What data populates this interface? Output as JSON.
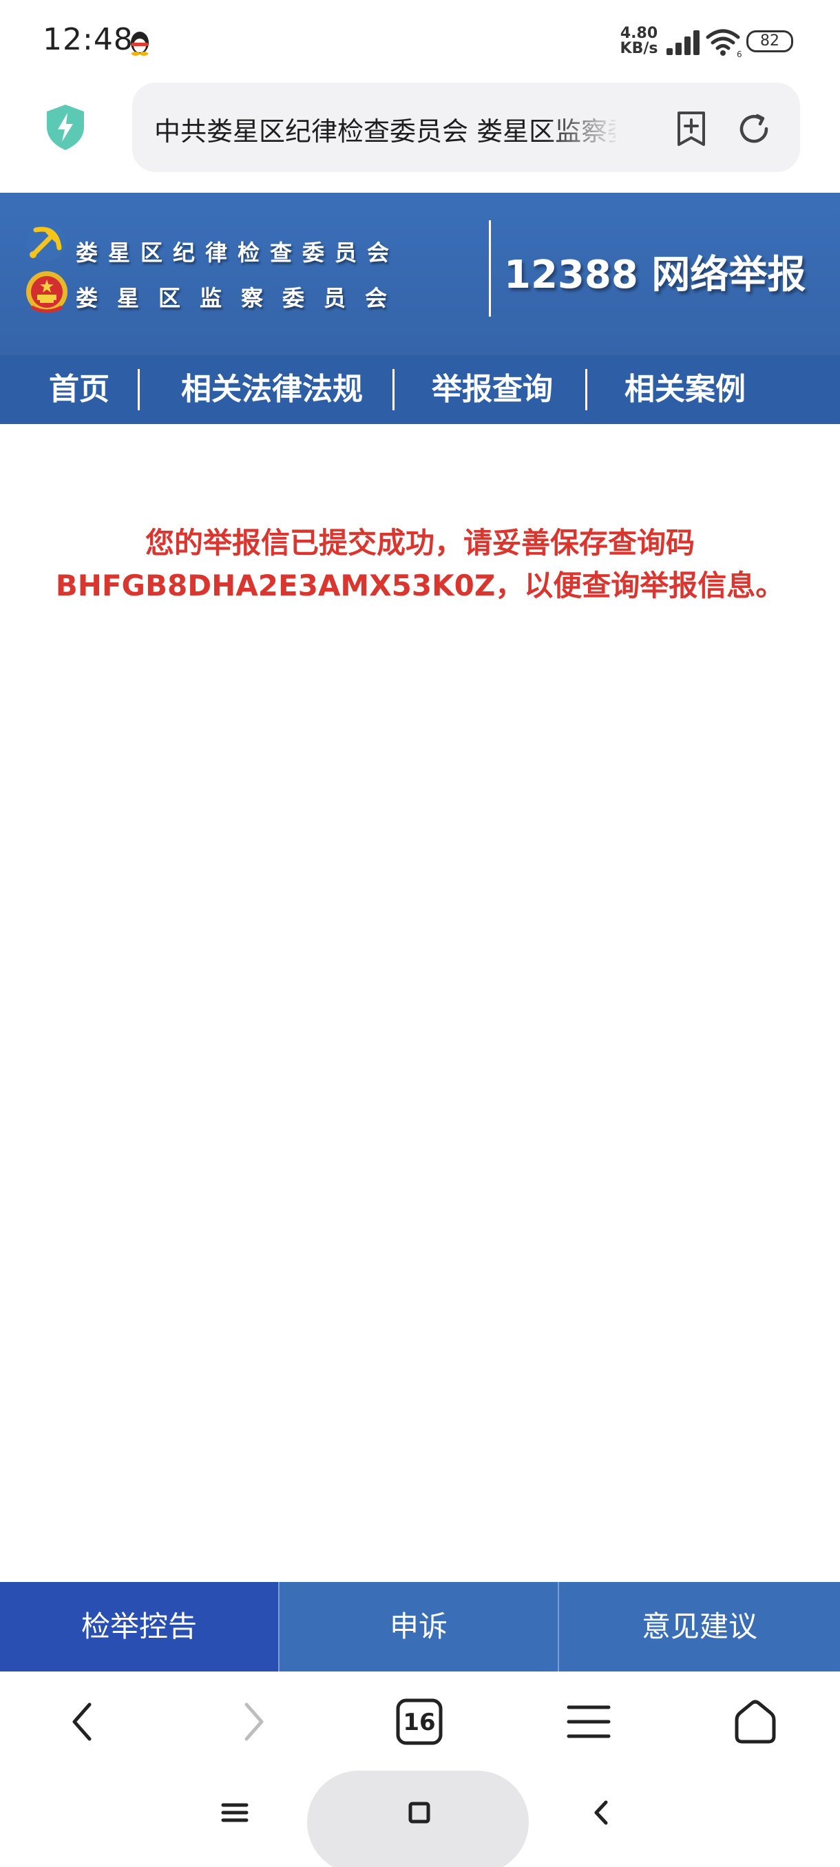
{
  "status_bar": {
    "time": "12:48",
    "net_speed_value": "4.80",
    "net_speed_unit": "KB/s",
    "wifi_badge": "6",
    "battery": "82"
  },
  "browser": {
    "url_title": "中共娄星区纪律检查委员会 娄星区监察委员会"
  },
  "header": {
    "org_line_1": "娄星区纪律检查委员会",
    "org_line_2": "娄星区监察委员会",
    "hotline": "12388 网络举报"
  },
  "nav": {
    "items": [
      {
        "label": "首页"
      },
      {
        "label": "相关法律法规"
      },
      {
        "label": "举报查询"
      },
      {
        "label": "相关案例"
      }
    ]
  },
  "message": {
    "line1": "您的举报信已提交成功，请妥善保存查询码",
    "line2": "BHFGB8DHA2E3AMX53K0Z，以便查询举报信息。"
  },
  "actions": {
    "items": [
      {
        "label": "检举控告"
      },
      {
        "label": "申诉"
      },
      {
        "label": "意见建议"
      }
    ]
  },
  "toolbar": {
    "tab_count": "16"
  },
  "colors": {
    "header_blue": "#3a6fb8",
    "nav_blue": "#2e5fa6",
    "active_action": "#2a4fb3",
    "message_red": "#d9362f"
  }
}
